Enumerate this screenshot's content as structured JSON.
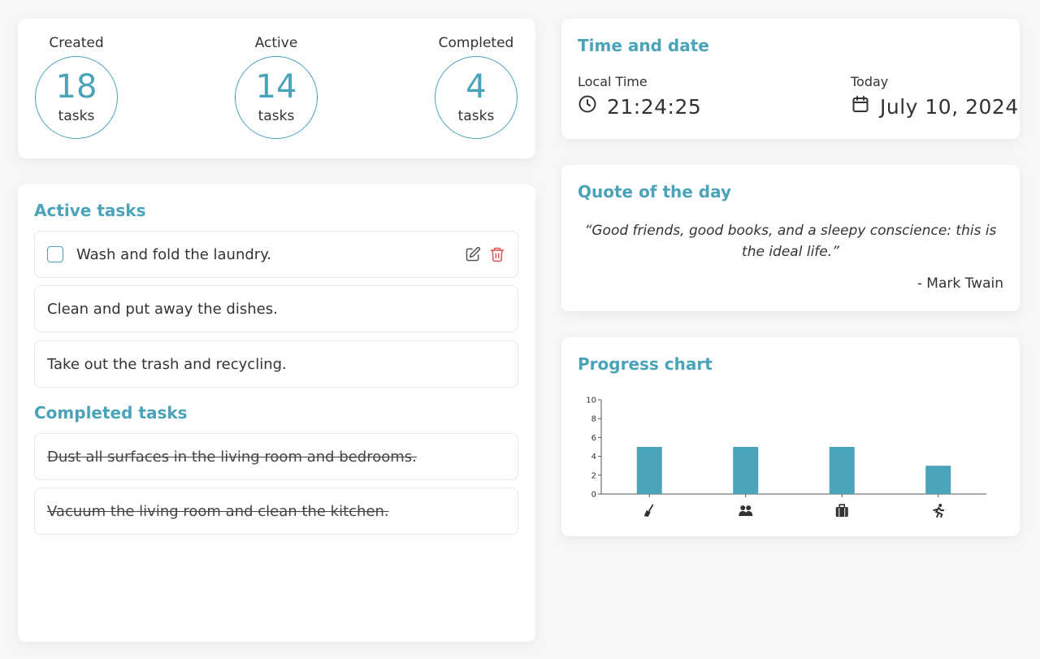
{
  "stats": {
    "created": {
      "label": "Created",
      "count": "18",
      "unit": "tasks"
    },
    "active": {
      "label": "Active",
      "count": "14",
      "unit": "tasks"
    },
    "completed": {
      "label": "Completed",
      "count": "4",
      "unit": "tasks"
    }
  },
  "tasks": {
    "active_title": "Active tasks",
    "active": [
      {
        "text": "Wash and fold the laundry."
      },
      {
        "text": "Clean and put away the dishes."
      },
      {
        "text": "Take out the trash and recycling."
      }
    ],
    "completed_title": "Completed tasks",
    "completed": [
      {
        "text": "Dust all surfaces in the living room and bedrooms."
      },
      {
        "text": "Vacuum the living room and clean the kitchen."
      }
    ]
  },
  "time": {
    "title": "Time and date",
    "local_label": "Local Time",
    "local_value": "21:24:25",
    "today_label": "Today",
    "today_value": "July 10, 2024"
  },
  "quote": {
    "title": "Quote of the day",
    "text": "“Good friends, good books, and a sleepy conscience: this is the ideal life.”",
    "author": "- Mark Twain"
  },
  "chart_data": {
    "title": "Progress chart",
    "type": "bar",
    "categories": [
      "cleaning",
      "social",
      "work",
      "exercise"
    ],
    "category_icons": [
      "broom-icon",
      "people-icon",
      "briefcase-icon",
      "running-icon"
    ],
    "values": [
      5,
      5,
      5,
      3
    ],
    "ylim": [
      0,
      10
    ],
    "yticks": [
      "0",
      "2",
      "4",
      "6",
      "8",
      "10"
    ],
    "grid": false,
    "bar_color": "#4aa3b8"
  },
  "colors": {
    "accent": "#4aa3b8",
    "delete": "#e05252",
    "background": "#f7f7f7"
  }
}
